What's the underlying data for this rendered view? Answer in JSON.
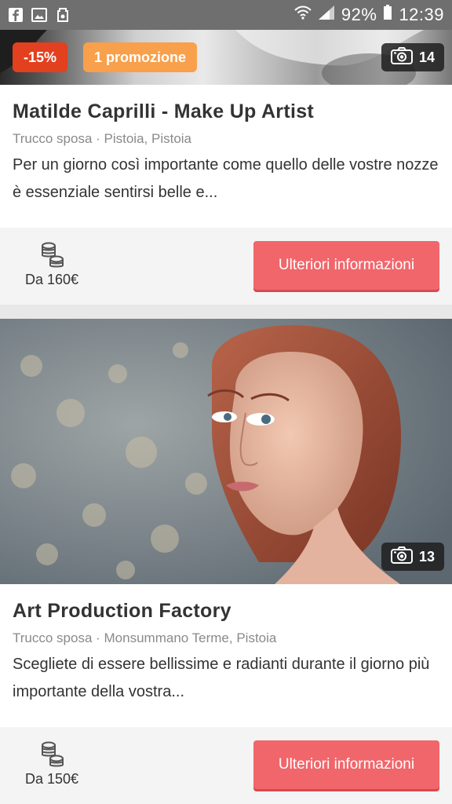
{
  "status_bar": {
    "battery_percent": "92%",
    "time": "12:39",
    "icons": [
      "facebook-icon",
      "gallery-icon",
      "storage-icon",
      "wifi-icon",
      "signal-icon",
      "battery-icon"
    ]
  },
  "listings": [
    {
      "discount_badge": "-15%",
      "promo_badge": "1 promozione",
      "photo_count": "14",
      "title": "Matilde Caprilli - Make Up Artist",
      "meta": "Trucco sposa · Pistoia, Pistoia",
      "description": "Per un giorno così importante come quello delle vostre nozze è essenziale sentirsi belle e...",
      "price": "Da 160€",
      "cta_label": "Ulteriori informazioni"
    },
    {
      "photo_count": "13",
      "title": "Art Production Factory",
      "meta": "Trucco sposa · Monsummano Terme, Pistoia",
      "description": "Scegliete di essere bellissime e radianti durante il giorno più importante della vostra...",
      "price": "Da 150€",
      "cta_label": "Ulteriori informazioni"
    }
  ],
  "colors": {
    "accent_button": "#f1666b",
    "discount_badge": "#e2401f",
    "promo_badge": "#f8a04b",
    "status_bar": "#6f6f6f"
  }
}
